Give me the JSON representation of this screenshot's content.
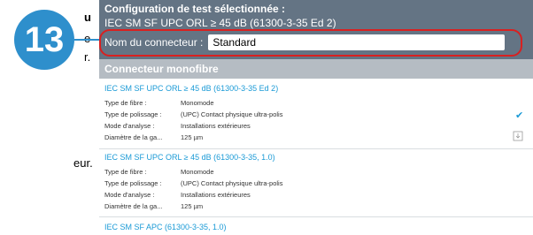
{
  "left_fragments": [
    {
      "text": "u",
      "bold": true
    },
    {
      "text": "e",
      "bold": false
    },
    {
      "text": "r.",
      "bold": false
    },
    {
      "text": "eur.",
      "bold": false
    }
  ],
  "badge": {
    "number": "13",
    "color": "#2e8fcc"
  },
  "header": {
    "title": "Configuration de test sélectionnée :",
    "standard": "IEC SM SF UPC ORL ≥ 45 dB (61300-3-35 Ed 2)",
    "connector_label": "Nom du connecteur :",
    "connector_value": "Standard"
  },
  "section": {
    "title": "Connecteur monofibre"
  },
  "entries": [
    {
      "title": "IEC SM SF UPC ORL ≥ 45 dB (61300-3-35 Ed 2)",
      "rows": [
        {
          "k": "Type de fibre :",
          "v": "Monomode"
        },
        {
          "k": "Type de polissage :",
          "v": "(UPC) Contact physique ultra-polis"
        },
        {
          "k": "Mode d'analyse :",
          "v": "Installations extérieures"
        },
        {
          "k": "Diamètre de la ga...",
          "v": "125 µm"
        }
      ]
    },
    {
      "title": "IEC SM SF UPC ORL ≥ 45 dB (61300-3-35, 1.0)",
      "rows": [
        {
          "k": "Type de fibre :",
          "v": "Monomode"
        },
        {
          "k": "Type de polissage :",
          "v": "(UPC) Contact physique ultra-polis"
        },
        {
          "k": "Mode d'analyse :",
          "v": "Installations extérieures"
        },
        {
          "k": "Diamètre de la ga...",
          "v": "125 µm"
        }
      ]
    },
    {
      "title": "IEC SM SF APC (61300-3-35, 1.0)",
      "rows": []
    }
  ],
  "icons": {
    "selected": "checkmark-icon",
    "download": "download-icon"
  },
  "colors": {
    "accent": "#1a9ad6",
    "header_bg": "#647484",
    "highlight": "#d92020"
  }
}
